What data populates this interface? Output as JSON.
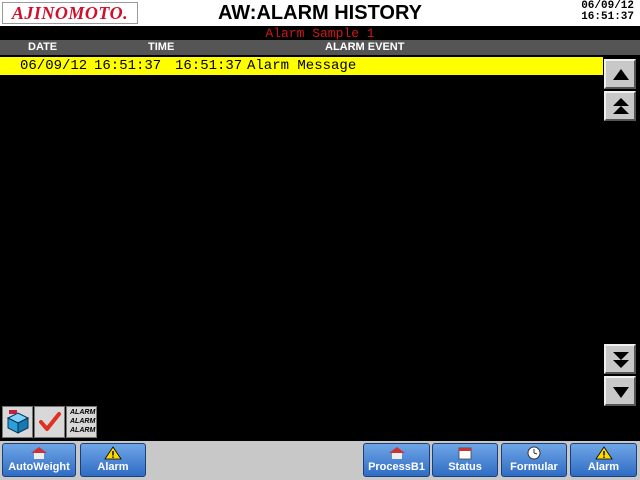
{
  "header": {
    "logo_text": "AJINOMOTO.",
    "title": "AW:ALARM HISTORY",
    "date": "06/09/12",
    "time": "16:51:37"
  },
  "subtitle": "Alarm Sample 1",
  "columns": {
    "date": "DATE",
    "time": "TIME",
    "event": "ALARM EVENT"
  },
  "rows": [
    {
      "date": "06/09/12",
      "time": "16:51:37",
      "time2": "16:51:37",
      "event": "Alarm Message",
      "highlight": "#ffff00"
    }
  ],
  "scroll_buttons": [
    "scroll-up-icon",
    "page-up-icon",
    "page-down-icon",
    "scroll-down-icon"
  ],
  "tools": {
    "reset_icon": "box-icon",
    "ack_icon": "checkmark-icon",
    "alarm_list_text": "ALARM"
  },
  "nav": [
    {
      "label": "AutoWeight",
      "icon": "house-icon"
    },
    {
      "label": "Alarm",
      "icon": "warning-icon"
    },
    {
      "label": "ProcessB1",
      "icon": "house-icon"
    },
    {
      "label": "Status",
      "icon": "calendar-icon"
    },
    {
      "label": "Formular",
      "icon": "clock-icon"
    },
    {
      "label": "Alarm",
      "icon": "warning-icon"
    }
  ],
  "colors": {
    "row_highlight": "#ffff00",
    "subtitle": "#d01818",
    "logo": "#d0102a",
    "nav_button": "#3d7bd0"
  }
}
